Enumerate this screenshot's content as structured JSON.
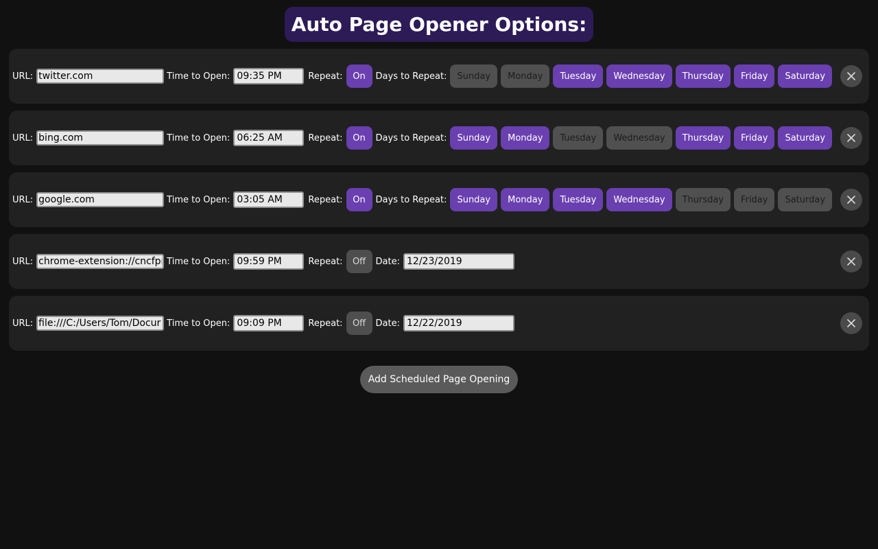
{
  "header": {
    "title": "Auto Page Opener Options:"
  },
  "labels": {
    "url": "URL:",
    "time_to_open": "Time to Open:",
    "repeat": "Repeat:",
    "days_to_repeat": "Days to Repeat:",
    "date": "Date:"
  },
  "colors": {
    "accent": "#6a3fb0",
    "title_bg": "#2d1b57",
    "row_bg": "#212121",
    "off": "#505050"
  },
  "rows": [
    {
      "url": "twitter.com",
      "time": "09:35 PM",
      "repeat_label": "On",
      "repeat": true,
      "days": [
        {
          "label": "Sunday",
          "on": false
        },
        {
          "label": "Monday",
          "on": false
        },
        {
          "label": "Tuesday",
          "on": true
        },
        {
          "label": "Wednesday",
          "on": true
        },
        {
          "label": "Thursday",
          "on": true
        },
        {
          "label": "Friday",
          "on": true
        },
        {
          "label": "Saturday",
          "on": true
        }
      ]
    },
    {
      "url": "bing.com",
      "time": "06:25 AM",
      "repeat_label": "On",
      "repeat": true,
      "days": [
        {
          "label": "Sunday",
          "on": true
        },
        {
          "label": "Monday",
          "on": true
        },
        {
          "label": "Tuesday",
          "on": false
        },
        {
          "label": "Wednesday",
          "on": false
        },
        {
          "label": "Thursday",
          "on": true
        },
        {
          "label": "Friday",
          "on": true
        },
        {
          "label": "Saturday",
          "on": true
        }
      ]
    },
    {
      "url": "google.com",
      "time": "03:05 AM",
      "repeat_label": "On",
      "repeat": true,
      "days": [
        {
          "label": "Sunday",
          "on": true
        },
        {
          "label": "Monday",
          "on": true
        },
        {
          "label": "Tuesday",
          "on": true
        },
        {
          "label": "Wednesday",
          "on": true
        },
        {
          "label": "Thursday",
          "on": false
        },
        {
          "label": "Friday",
          "on": false
        },
        {
          "label": "Saturday",
          "on": false
        }
      ]
    },
    {
      "url": "chrome-extension://cncfpr",
      "time": "09:59 PM",
      "repeat_label": "Off",
      "repeat": false,
      "date": "12/23/2019"
    },
    {
      "url": "file:///C:/Users/Tom/Docur",
      "time": "09:09 PM",
      "repeat_label": "Off",
      "repeat": false,
      "date": "12/22/2019"
    }
  ],
  "icons": {
    "close": "close-icon"
  },
  "footer": {
    "add_label": "Add Scheduled Page Opening"
  }
}
